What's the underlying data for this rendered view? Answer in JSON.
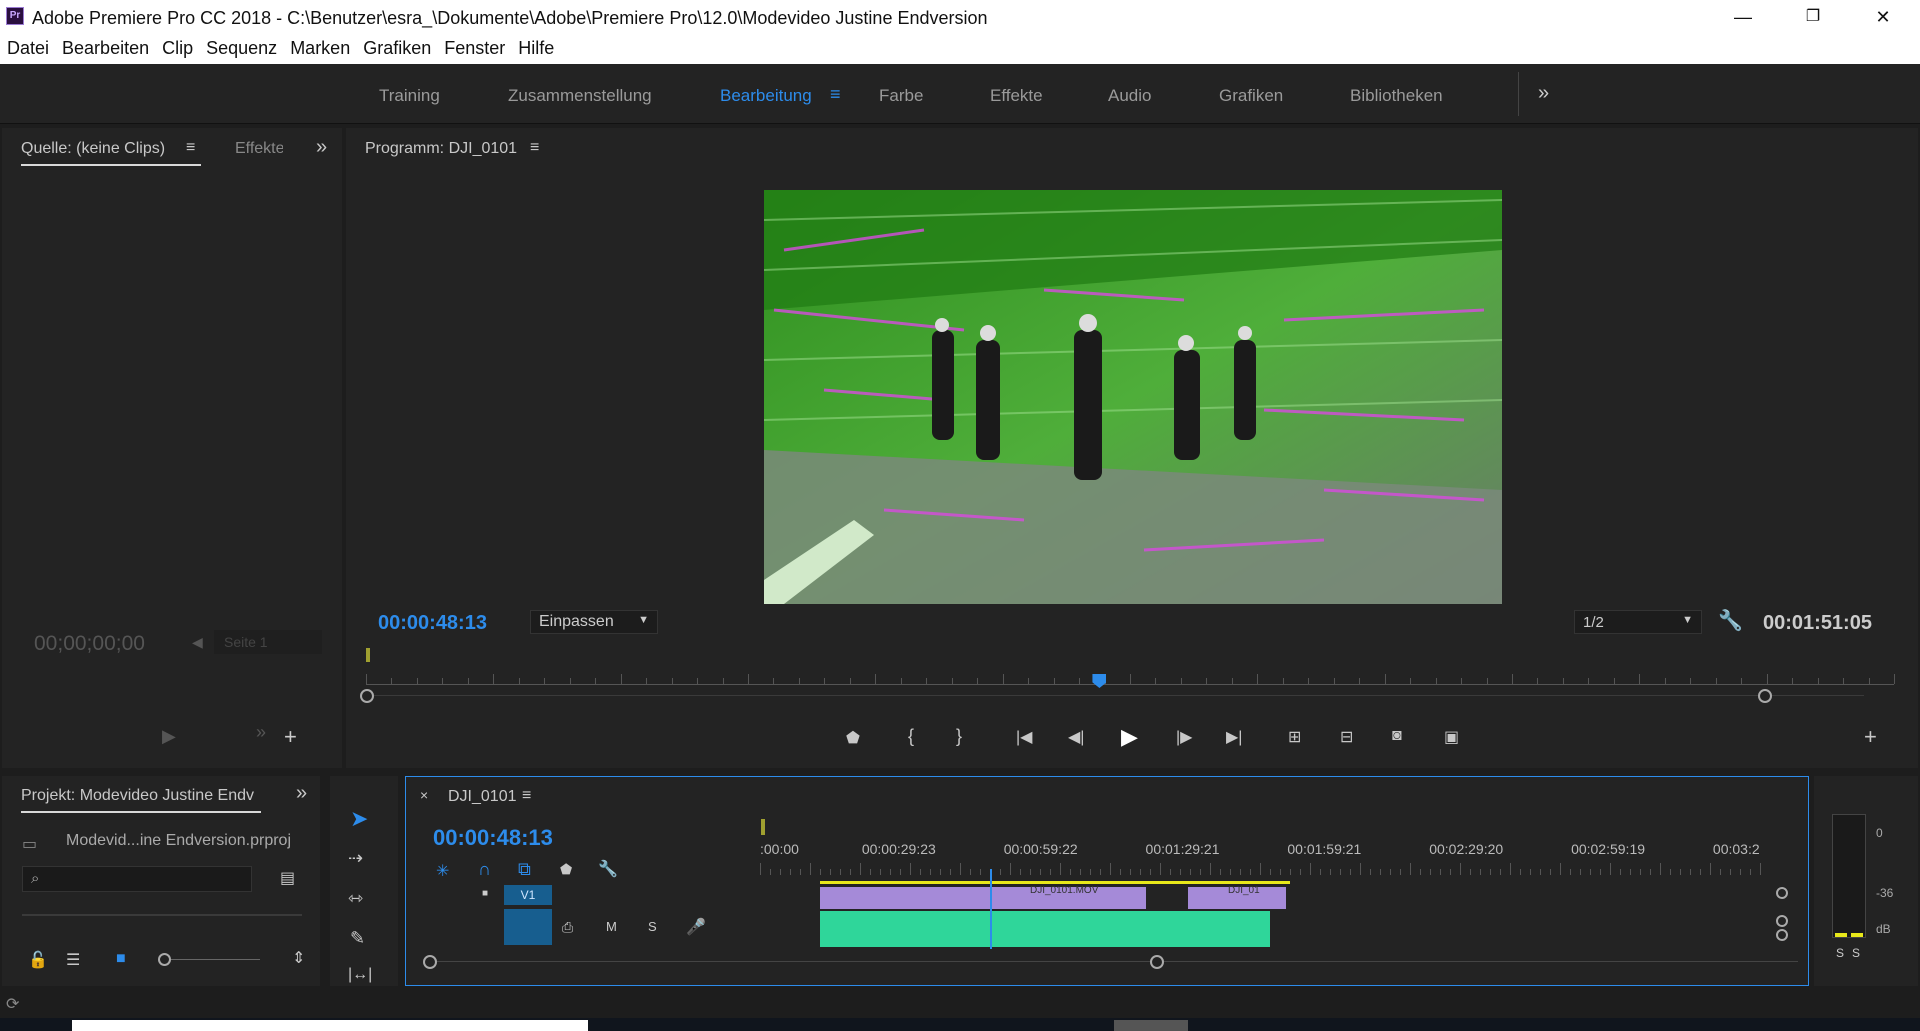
{
  "window": {
    "title": "Adobe Premiere Pro CC 2018 - C:\\Benutzer\\esra_\\Dokumente\\Adobe\\Premiere Pro\\12.0\\Modevideo Justine Endversion",
    "app_icon": "Pr"
  },
  "menu": [
    "Datei",
    "Bearbeiten",
    "Clip",
    "Sequenz",
    "Marken",
    "Grafiken",
    "Fenster",
    "Hilfe"
  ],
  "workspaces": {
    "items": [
      "Training",
      "Zusammenstellung",
      "Bearbeitung",
      "Farbe",
      "Effekte",
      "Audio",
      "Grafiken",
      "Bibliotheken"
    ],
    "active": "Bearbeitung"
  },
  "source_panel": {
    "tab_label": "Quelle: (keine Clips)",
    "tab2_label": "Effekte",
    "timecode": "00;00;00;00",
    "page_label": "Seite 1"
  },
  "program_monitor": {
    "tab_label": "Programm: DJI_0101",
    "current_timecode": "00:00:48:13",
    "zoom": "Einpassen",
    "resolution": "1/2",
    "duration": "00:01:51:05",
    "playhead_position": 0.48
  },
  "project_panel": {
    "tab_label": "Projekt: Modevideo Justine Endv",
    "file_name": "Modevid...ine Endversion.prproj",
    "search_placeholder": ""
  },
  "timeline": {
    "sequence_name": "DJI_0101",
    "current_timecode": "00:00:48:13",
    "ruler_labels": [
      ":00:00",
      "00:00:29:23",
      "00:00:59:22",
      "00:01:29:21",
      "00:01:59:21",
      "00:02:29:20",
      "00:02:59:19",
      "00:03:2"
    ],
    "video_track": "V1",
    "audio_buttons": [
      "M",
      "S"
    ],
    "clip_labels": [
      "DJI_0101.MOV",
      "DJI_01"
    ],
    "playhead_fraction": 0.23
  },
  "audio_meter": {
    "labels": [
      "0",
      "-36",
      "dB"
    ],
    "solo_labels": [
      "S",
      "S"
    ]
  },
  "colors": {
    "accent": "#2d8ceb",
    "video_clip": "#a58ad8",
    "audio_clip": "#2fd69a",
    "work_area": "#e8e81a"
  }
}
